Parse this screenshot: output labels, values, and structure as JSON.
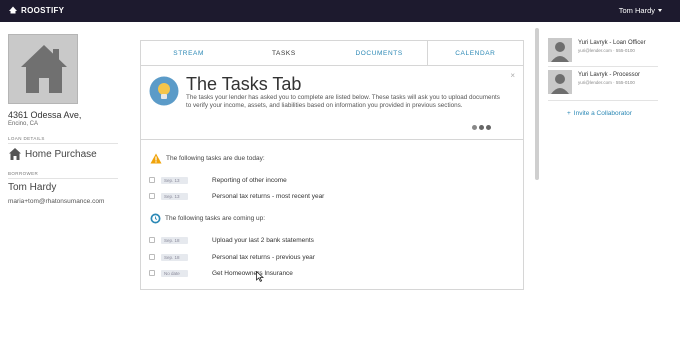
{
  "app": {
    "brand": "ROOSTIFY",
    "user_name": "Tom Hardy"
  },
  "property": {
    "address": "4361 Odessa Ave,",
    "city": "Encino, CA",
    "loan_details_label": "LOAN DETAILS",
    "loan_type": "Home Purchase",
    "borrower_label": "BORROWER",
    "borrower_name": "Tom Hardy",
    "borrower_email": "maria+tom@rhatonsumance.com"
  },
  "tabs": [
    {
      "label": "STREAM"
    },
    {
      "label": "TASKS"
    },
    {
      "label": "DOCUMENTS"
    },
    {
      "label": "CALENDAR"
    }
  ],
  "intro": {
    "title": "The Tasks Tab",
    "description": "The tasks your lender has asked you to complete are listed below. These tasks will ask you to upload documents to verify your income, assets, and liabilities based on information you provided in previous sections.",
    "close": "×"
  },
  "groups": {
    "due_today": {
      "heading": "The following tasks are due today:",
      "tasks": [
        {
          "date": "Sep. 13",
          "label": "Reporting of other income"
        },
        {
          "date": "Sep. 13",
          "label": "Personal tax returns - most recent year"
        }
      ]
    },
    "upcoming": {
      "heading": "The following tasks are coming up:",
      "tasks": [
        {
          "date": "Sep. 18",
          "label": "Upload your last 2 bank statements"
        },
        {
          "date": "Sep. 18",
          "label": "Personal tax returns - previous year"
        },
        {
          "date": "No date",
          "label": "Get Homeowners Insurance"
        }
      ]
    }
  },
  "collaborators": [
    {
      "name": "Yuri Lavryk - Loan Officer",
      "sub": "yuri@lender.com · 555-0100"
    },
    {
      "name": "Yuri Lavryk - Processor",
      "sub": "yuri@lender.com · 555-0100"
    }
  ],
  "invite_label": "Invite a Collaborator",
  "colors": {
    "nav": "#1d1a2e",
    "accent": "#2b88b5",
    "warning": "#f0a30a",
    "info": "#2b88b5"
  }
}
